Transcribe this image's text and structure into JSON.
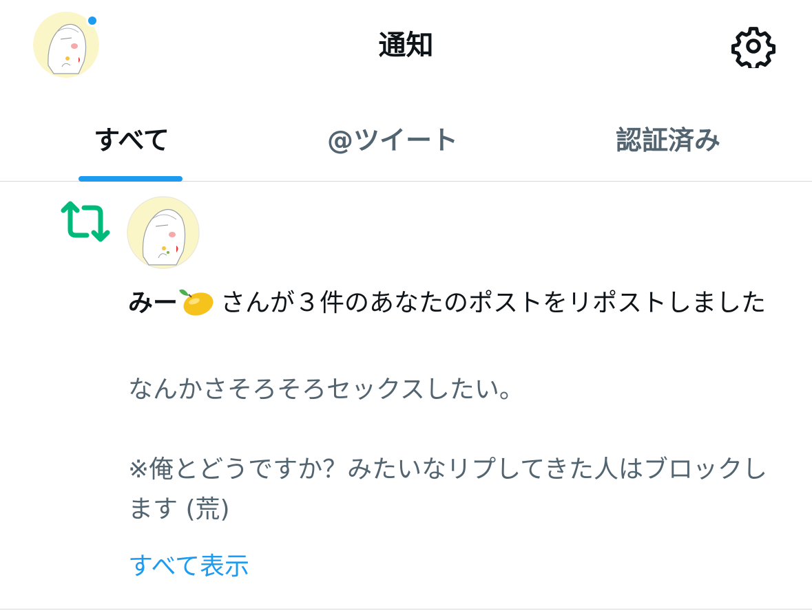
{
  "header": {
    "title": "通知",
    "avatar_icon": "profile-avatar",
    "settings_icon": "gear-icon",
    "unread_dot_color": "#1d9bf0"
  },
  "tabs": [
    {
      "label": "すべて",
      "active": true
    },
    {
      "label": "@ツイート",
      "active": false
    },
    {
      "label": "認証済み",
      "active": false
    }
  ],
  "notification": {
    "type_icon": "retweet-icon",
    "type_icon_color": "#00ba7c",
    "actor_name": "みー",
    "actor_emoji": "lemon-emoji",
    "message": "さんが３件のあなたのポストをリポストしました",
    "post_text": "なんかさそろそろセックスしたい。\n\n※俺とどうですか？みたいなリプしてきた人はブロックします (荒)",
    "show_all_label": "すべて表示"
  },
  "colors": {
    "accent": "#1d9bf0",
    "text_primary": "#0f1419",
    "text_secondary": "#536471",
    "divider": "#cfd9de",
    "retweet": "#00ba7c"
  }
}
